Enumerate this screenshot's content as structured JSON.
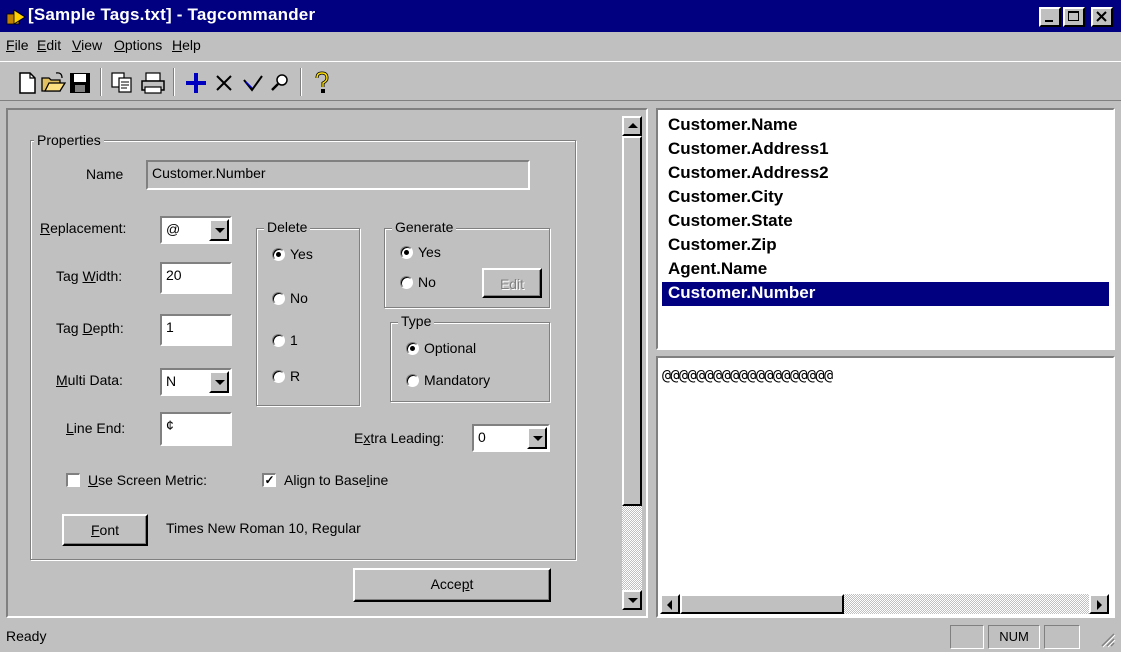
{
  "window": {
    "title": "[Sample Tags.txt] - Tagcommander",
    "minimize_icon": "minimize-icon",
    "maximize_icon": "maximize-icon",
    "close_icon": "close-icon"
  },
  "menu": [
    {
      "label": "File",
      "mnemonic": "F",
      "rest": "ile"
    },
    {
      "label": "Edit",
      "mnemonic": "E",
      "rest": "dit"
    },
    {
      "label": "View",
      "mnemonic": "V",
      "rest": "iew"
    },
    {
      "label": "Options",
      "mnemonic": "O",
      "rest": "ptions"
    },
    {
      "label": "Help",
      "mnemonic": "H",
      "rest": "elp"
    }
  ],
  "toolbar": [
    "new-file-icon",
    "open-folder-icon",
    "save-disk-icon",
    "copy-icon",
    "print-icon",
    "add-plus-icon",
    "delete-x-icon",
    "check-icon",
    "find-magnifier-icon",
    "help-question-icon"
  ],
  "properties": {
    "group_label": "Properties",
    "name_label": "Name",
    "name_value": "Customer.Number",
    "replacement_label_u": "R",
    "replacement_label_rest": "eplacement:",
    "replacement_value": "@",
    "tag_width_label_pre": "Tag ",
    "tag_width_label_u": "W",
    "tag_width_label_rest": "idth:",
    "tag_width_value": "20",
    "tag_depth_label_pre": "Tag ",
    "tag_depth_label_u": "D",
    "tag_depth_label_rest": "epth:",
    "tag_depth_value": "1",
    "multi_data_label_u": "M",
    "multi_data_label_rest": "ulti Data:",
    "multi_data_value": "N",
    "line_end_label_u": "L",
    "line_end_label_rest": "ine End:",
    "line_end_value": "¢",
    "delete": {
      "label": "Delete",
      "options": [
        "Yes",
        "No",
        "1",
        "R"
      ],
      "selected": "Yes"
    },
    "generate": {
      "label": "Generate",
      "options": [
        "Yes",
        "No"
      ],
      "selected": "Yes",
      "edit_label": "Edit"
    },
    "type": {
      "label": "Type",
      "options": [
        "Optional",
        "Mandatory"
      ],
      "selected": "Optional"
    },
    "extra_leading_label_pre": "E",
    "extra_leading_label_u": "x",
    "extra_leading_label_rest": "tra Leading:",
    "extra_leading_value": "0",
    "use_screen_metric_u": "U",
    "use_screen_metric_rest": "se Screen Metric:",
    "use_screen_metric_checked": false,
    "align_to_baseline_pre": "Align to Base",
    "align_to_baseline_u": "l",
    "align_to_baseline_rest": "ine",
    "align_to_baseline_checked": true,
    "font_button_u": "F",
    "font_button_rest": "ont",
    "font_description": "Times New Roman 10, Regular",
    "accept_pre": "Acce",
    "accept_u": "p",
    "accept_rest": "t"
  },
  "tags": {
    "items": [
      "Customer.Name",
      "Customer.Address1",
      "Customer.Address2",
      "Customer.City",
      "Customer.State",
      "Customer.Zip",
      "Agent.Name",
      "Customer.Number"
    ],
    "selected": "Customer.Number"
  },
  "preview": {
    "text": "@@@@@@@@@@@@@@@@@@@@"
  },
  "status": {
    "text": "Ready",
    "num": "NUM"
  },
  "colors": {
    "titlebar": "#000080",
    "face": "#c0c0c0",
    "selection": "#000080"
  }
}
